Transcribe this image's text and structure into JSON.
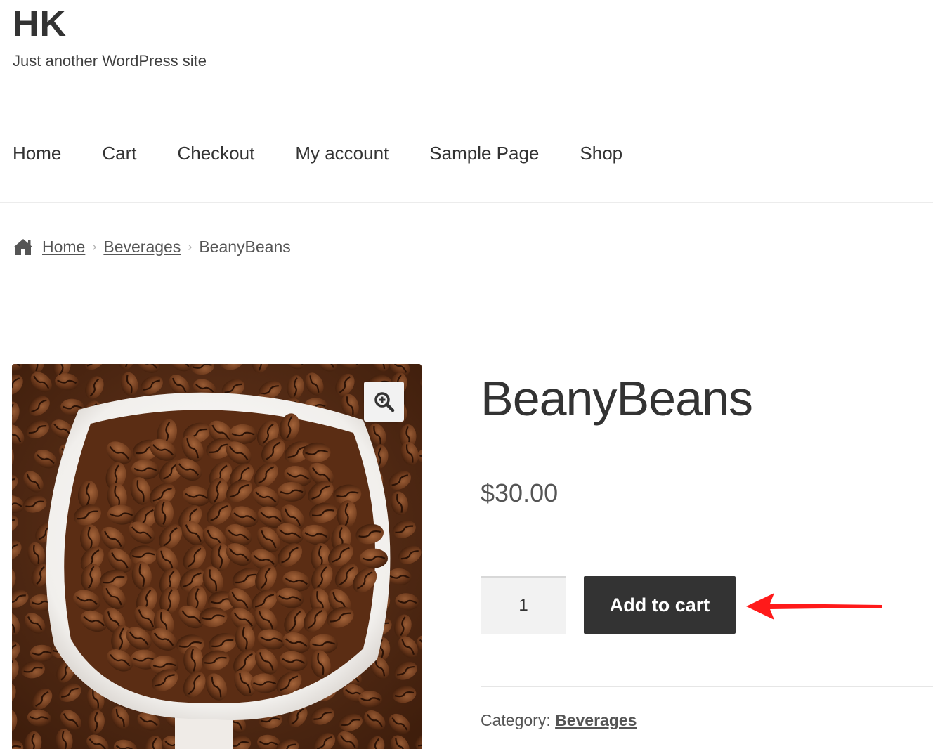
{
  "site": {
    "title": "HK",
    "description": "Just another WordPress site"
  },
  "nav": {
    "items": [
      {
        "label": "Home"
      },
      {
        "label": "Cart"
      },
      {
        "label": "Checkout"
      },
      {
        "label": "My account"
      },
      {
        "label": "Sample Page"
      },
      {
        "label": "Shop"
      }
    ]
  },
  "breadcrumb": {
    "icon": "home-icon",
    "items": [
      {
        "label": "Home"
      },
      {
        "label": "Beverages"
      }
    ],
    "current": "BeanyBeans"
  },
  "product": {
    "image_icon": "zoom-in-icon",
    "title": "BeanyBeans",
    "price": "$30.00",
    "quantity": "1",
    "add_to_cart_label": "Add to cart",
    "category_label": "Category:",
    "category_value": "Beverages"
  },
  "annotation": {
    "icon": "red-arrow-icon",
    "color": "#ff0000"
  },
  "colors": {
    "button_bg": "#333333",
    "button_text": "#ffffff",
    "qty_bg": "#f2f2f2"
  }
}
